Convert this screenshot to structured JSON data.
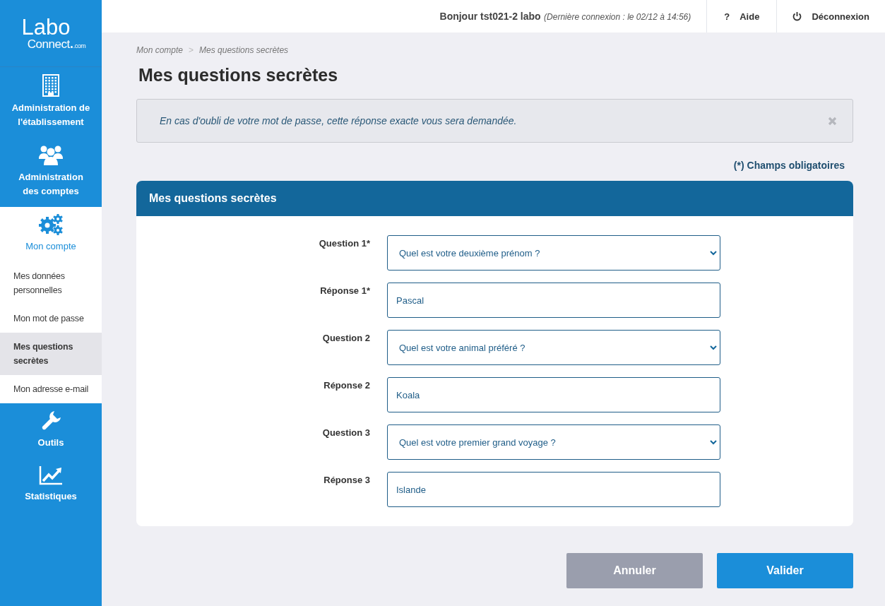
{
  "sidebar": {
    "logo": {
      "line1": "Labo",
      "line2": "Connect",
      "suffix": ".com"
    },
    "items": [
      {
        "kind": "section",
        "label": "Administration de l'établissement",
        "selected": false
      },
      {
        "kind": "section",
        "label": "Administration des comptes",
        "selected": false
      },
      {
        "kind": "section",
        "label": "Mon compte",
        "selected": true,
        "children": [
          {
            "label": "Mes données personnelles",
            "selected": false
          },
          {
            "label": "Mon mot de passe",
            "selected": false
          },
          {
            "label": "Mes questions secrètes",
            "selected": true
          },
          {
            "label": "Mon adresse e-mail",
            "selected": false
          }
        ]
      },
      {
        "kind": "section",
        "label": "Outils",
        "selected": false
      },
      {
        "kind": "section",
        "label": "Statistiques",
        "selected": false
      }
    ]
  },
  "header": {
    "greeting": "Bonjour tst021-2 labo",
    "last_login": "(Dernière connexion : le 02/12 à 14:56)",
    "actions": [
      {
        "kind": "help",
        "glyph": "?",
        "label": "Aide"
      },
      {
        "kind": "logout",
        "label": "Déconnexion"
      }
    ]
  },
  "breadcrumb": {
    "items": [
      "Mon compte",
      "Mes questions secrètes"
    ],
    "separator": ">"
  },
  "page_title": "Mes questions secrètes",
  "alert": {
    "text": "En cas d'oubli de votre mot de passe, cette réponse exacte vous sera demandée."
  },
  "required_note": "(*) Champs obligatoires",
  "panel": {
    "title": "Mes questions secrètes",
    "fields": [
      {
        "kind": "select",
        "label": "Question 1*",
        "value": "Quel est votre deuxième prénom ?"
      },
      {
        "kind": "input",
        "label": "Réponse 1*",
        "value": "Pascal"
      },
      {
        "kind": "select",
        "label": "Question 2",
        "value": "Quel est votre animal préféré ?"
      },
      {
        "kind": "input",
        "label": "Réponse 2",
        "value": "Koala"
      },
      {
        "kind": "select",
        "label": "Question 3",
        "value": "Quel est votre premier grand voyage ?"
      },
      {
        "kind": "input",
        "label": "Réponse 3",
        "value": "Islande"
      }
    ]
  },
  "buttons": [
    {
      "kind": "secondary",
      "label": "Annuler"
    },
    {
      "kind": "primary",
      "label": "Valider"
    }
  ]
}
